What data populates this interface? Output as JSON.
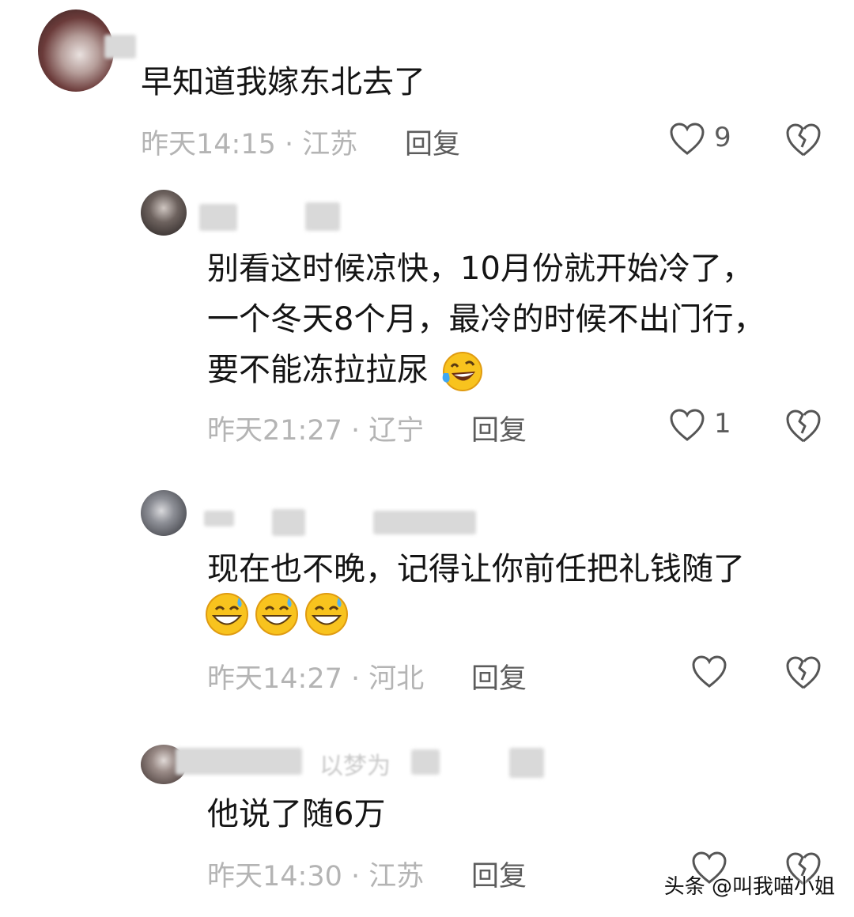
{
  "comments": [
    {
      "text_lines": [
        "早知道我嫁东北去了"
      ],
      "meta": "昨天14:15 · 江苏",
      "reply_label": "回复",
      "likes": "9"
    },
    {
      "text_lines": [
        "别看这时候凉快，10月份就开始冷了，",
        "一个冬天8个月，最冷的时候不出门行，",
        "要不能冻拉拉尿"
      ],
      "meta": "昨天21:27 · 辽宁",
      "reply_label": "回复",
      "likes": "1"
    },
    {
      "text_lines": [
        "现在也不晚，记得让你前任把礼钱随了"
      ],
      "meta": "昨天14:27 · 河北",
      "reply_label": "回复",
      "likes": ""
    },
    {
      "text_lines": [
        "他说了随6万"
      ],
      "meta": "昨天14:30 · 江苏",
      "reply_label": "回复",
      "likes": ""
    }
  ],
  "blurred_name_fragment": "以梦为",
  "watermark": "头条 @叫我喵小姐",
  "emoji": {
    "laugh_cry": "laughing-with-tears",
    "grin_sweat": "grinning-sweat"
  },
  "colors": {
    "text": "#141414",
    "meta": "#b4b4b4",
    "reply": "#5c5c5c",
    "icon": "#555555"
  }
}
